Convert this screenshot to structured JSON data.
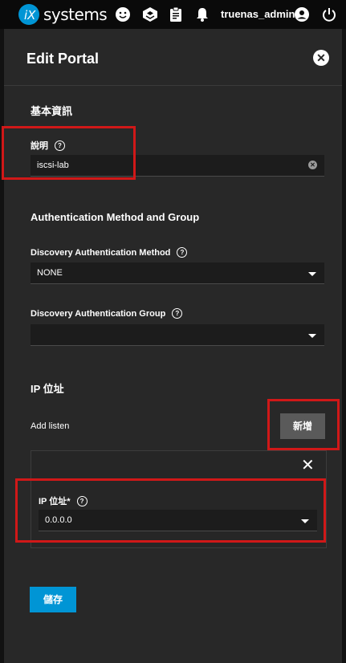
{
  "topbar": {
    "brand": "systems",
    "username": "truenas_admin",
    "icons": [
      "ix-logo-icon",
      "feedback-icon",
      "truecommand-icon",
      "clipboard-icon",
      "bell-icon",
      "account-circle-icon",
      "power-icon"
    ]
  },
  "panel": {
    "title": "Edit Portal",
    "basic_section": "基本資訊",
    "description_label": "說明",
    "description_value": "iscsi-lab",
    "auth_section": "Authentication Method and Group",
    "auth_method_label": "Discovery Authentication Method",
    "auth_method_value": "NONE",
    "auth_group_label": "Discovery Authentication Group",
    "auth_group_value": "",
    "ip_section": "IP 位址",
    "add_listen_label": "Add listen",
    "add_button": "新增",
    "ip_label": "IP 位址*",
    "ip_value": "0.0.0.0",
    "save_button": "儲存"
  },
  "colors": {
    "accent": "#0095d5",
    "highlight": "#d01818",
    "background": "#282828"
  }
}
